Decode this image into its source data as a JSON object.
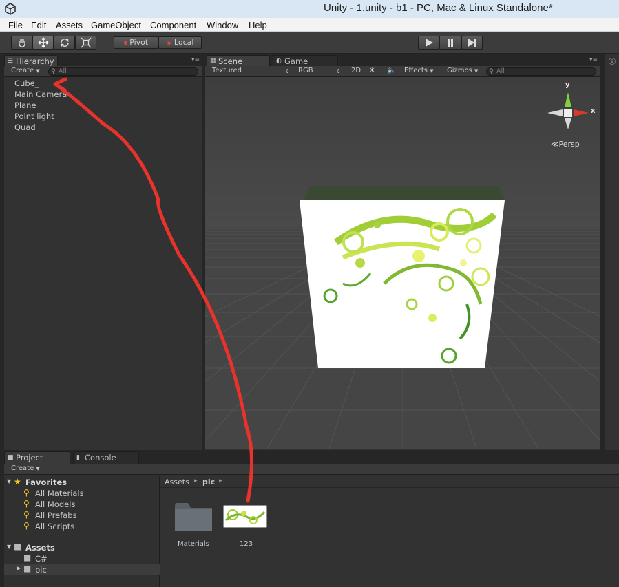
{
  "window": {
    "title": "Unity - 1.unity - b1 - PC, Mac & Linux Standalone*"
  },
  "menu": [
    "File",
    "Edit",
    "Assets",
    "GameObject",
    "Component",
    "Window",
    "Help"
  ],
  "toolbar": {
    "transform_tools": [
      "hand-icon",
      "move-icon",
      "rotate-icon",
      "scale-icon"
    ],
    "pivot_label": "Pivot",
    "local_label": "Local",
    "play_controls": [
      "play-icon",
      "pause-icon",
      "step-icon"
    ]
  },
  "hierarchy": {
    "tab_label": "Hierarchy",
    "create_label": "Create",
    "search_placeholder": "All",
    "items": [
      "Cube_",
      "Main Camera",
      "Plane",
      "Point light",
      "Quad"
    ]
  },
  "scene": {
    "tab_scene": "Scene",
    "tab_game": "Game",
    "render_mode": "Textured",
    "color_mode": "RGB",
    "toggle_2d": "2D",
    "effects_label": "Effects",
    "gizmos_label": "Gizmos",
    "search_placeholder": "All",
    "gizmo_y": "y",
    "gizmo_x": "x",
    "projection_label": "Persp"
  },
  "project": {
    "tab_project": "Project",
    "tab_console": "Console",
    "create_label": "Create",
    "favorites_label": "Favorites",
    "favorites": [
      "All Materials",
      "All Models",
      "All Prefabs",
      "All Scripts"
    ],
    "assets_label": "Assets",
    "asset_folders": [
      "C#",
      "pic"
    ],
    "breadcrumb": [
      "Assets",
      "pic"
    ],
    "grid_items": [
      "Materials",
      "123"
    ]
  },
  "colors": {
    "annotation_arrow": "#e8322c",
    "gizmo_y": "#7fd23a",
    "gizmo_x": "#d93a2a",
    "selected_row": "#3d3d3d"
  }
}
